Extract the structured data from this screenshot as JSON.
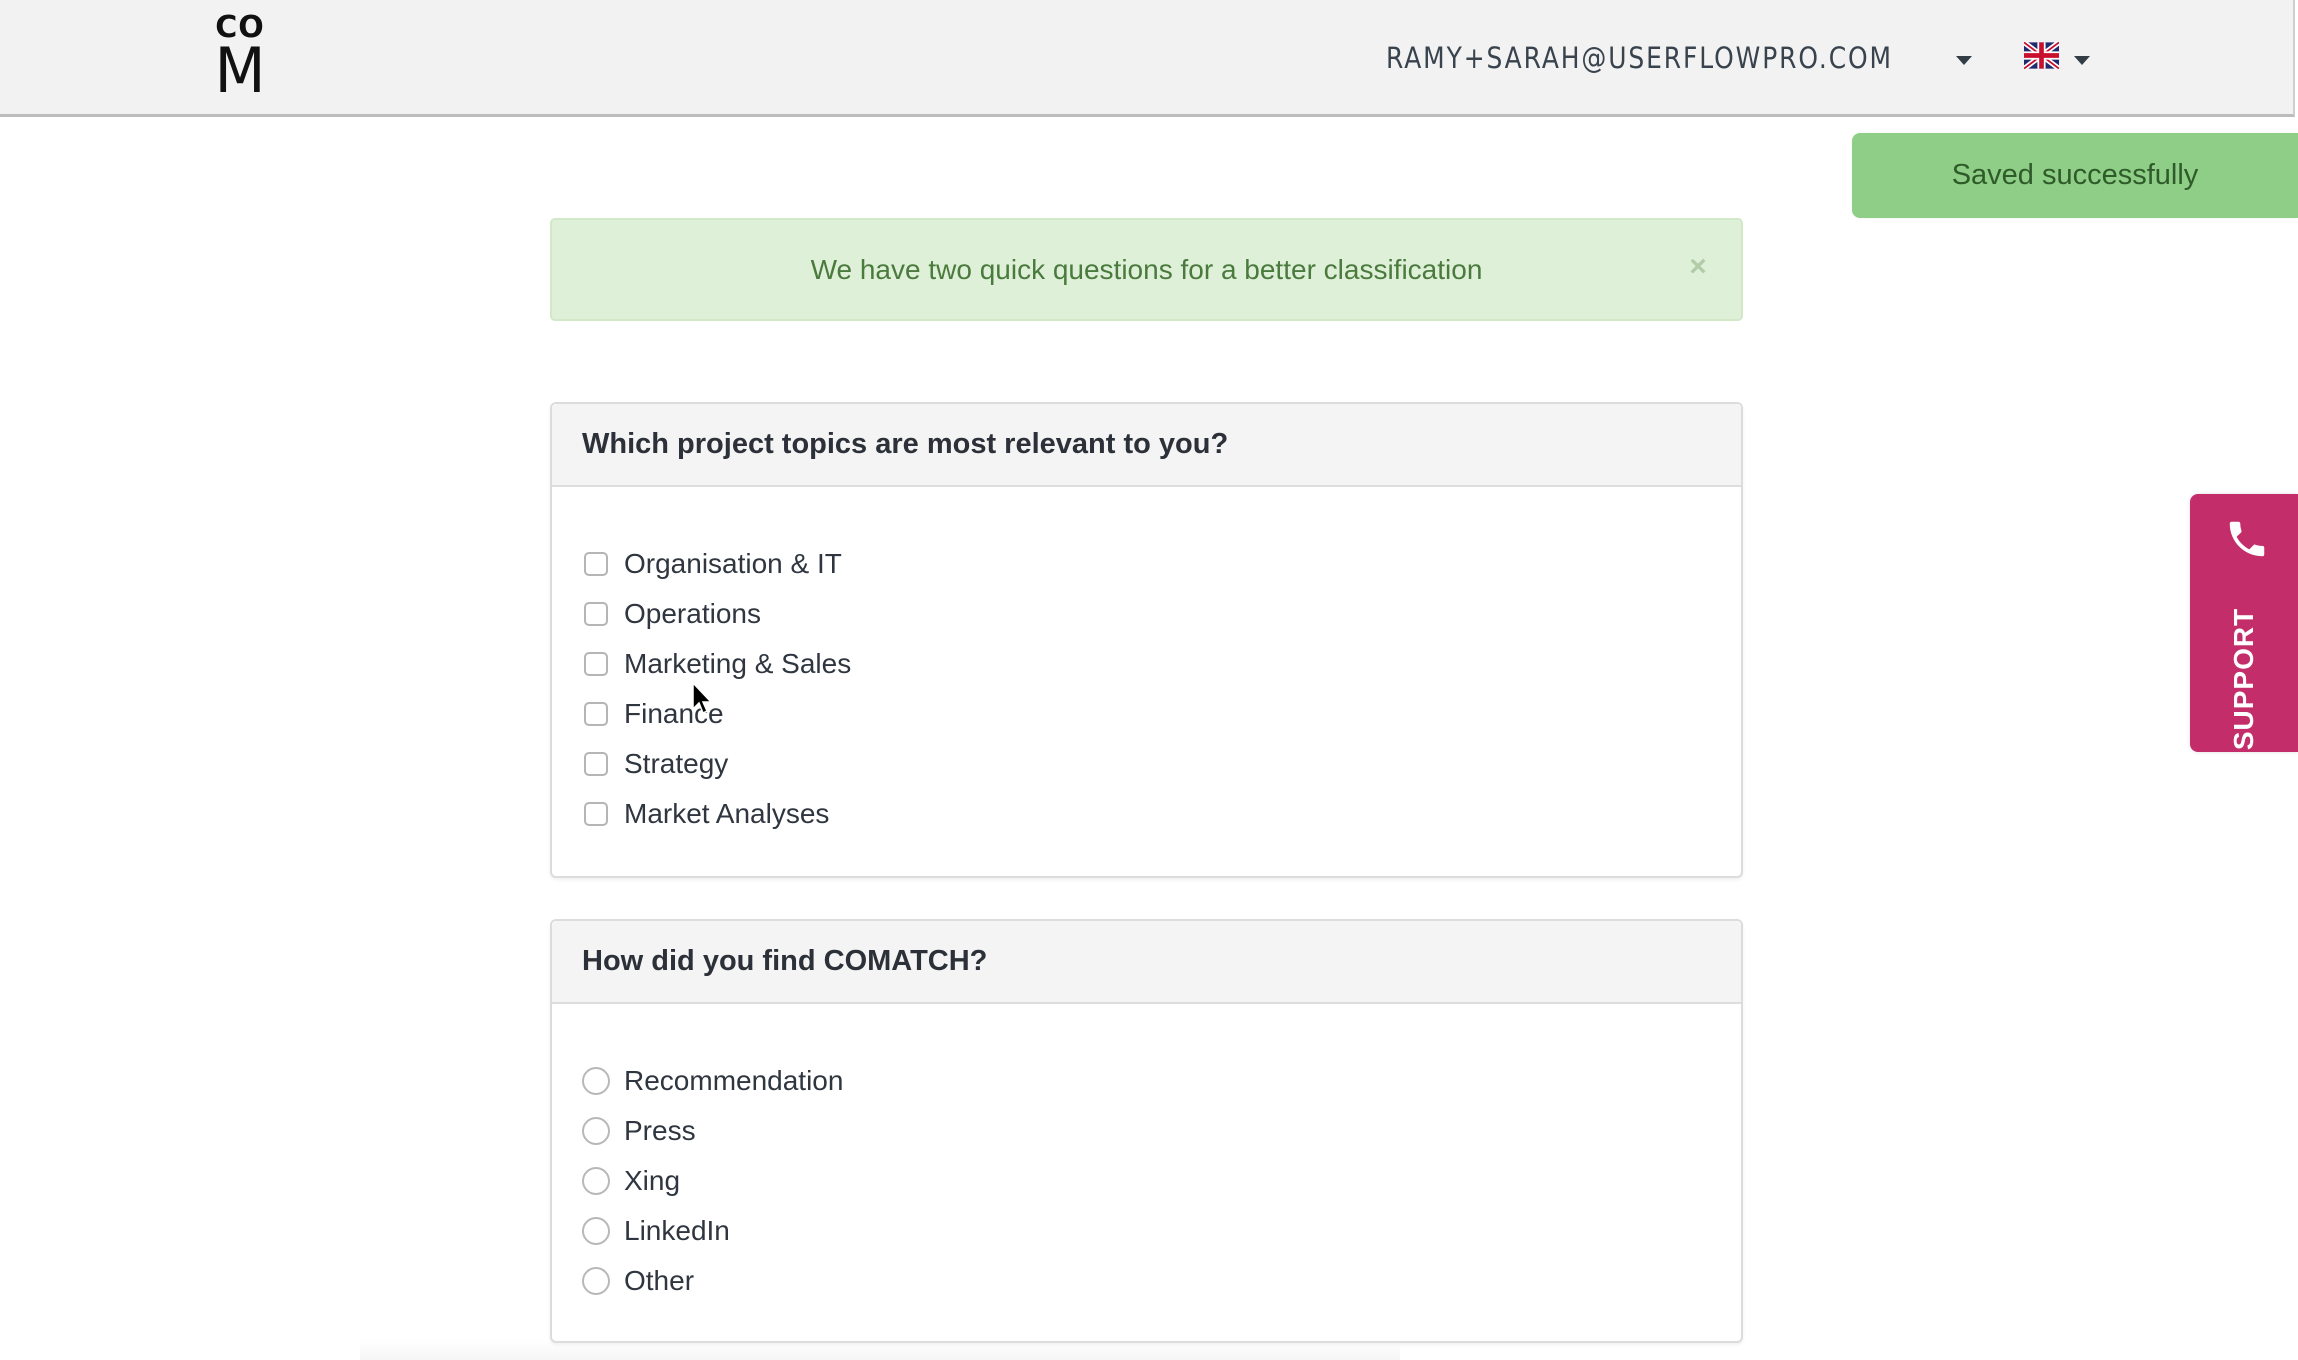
{
  "header": {
    "logo": {
      "line1": "CO",
      "line2": "M",
      "icon": "comatch-logo"
    },
    "user_email": "RAMY+SARAH@USERFLOWPRO.COM",
    "user_menu_icon": "caret-down-icon",
    "language": {
      "flag": "uk-flag-icon",
      "caret": "caret-down-icon"
    }
  },
  "toast": {
    "message": "Saved successfully",
    "color": "#8ece86"
  },
  "alert": {
    "message": "We have two quick questions for a better classification",
    "close_label": "×",
    "color": "#dff0d8"
  },
  "questions": [
    {
      "title": "Which project topics are most relevant to you?",
      "type": "checkbox",
      "options": [
        {
          "label": "Organisation & IT",
          "checked": false
        },
        {
          "label": "Operations",
          "checked": false
        },
        {
          "label": "Marketing & Sales",
          "checked": false
        },
        {
          "label": "Finance",
          "checked": false
        },
        {
          "label": "Strategy",
          "checked": false
        },
        {
          "label": "Market Analyses",
          "checked": false
        }
      ]
    },
    {
      "title": "How did you find COMATCH?",
      "type": "radio",
      "options": [
        {
          "label": "Recommendation",
          "checked": false
        },
        {
          "label": "Press",
          "checked": false
        },
        {
          "label": "Xing",
          "checked": false
        },
        {
          "label": "LinkedIn",
          "checked": false
        },
        {
          "label": "Other",
          "checked": false
        }
      ]
    }
  ],
  "support": {
    "label": "SUPPORT",
    "icon": "phone-icon",
    "color": "#c32d69"
  }
}
